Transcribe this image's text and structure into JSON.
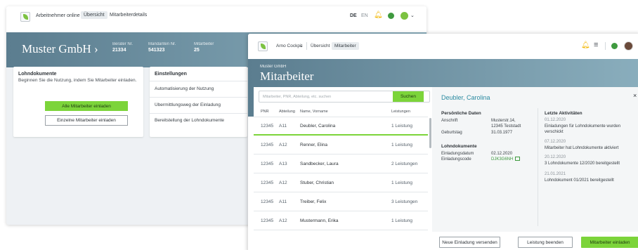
{
  "back": {
    "app_name": "Arbeitnehmer online",
    "tab_overview": "Übersicht",
    "tab_details": "Mitarbeiterdetails",
    "lang_de": "DE",
    "lang_en": "EN",
    "user_chevron": "⌄",
    "company": "Muster GmbH",
    "company_chevron": "›",
    "stats": [
      {
        "label": "Berater Nr.",
        "value": "21334"
      },
      {
        "label": "Mandanten Nr.",
        "value": "541323"
      },
      {
        "label": "Mitarbeiter",
        "value": "25"
      }
    ],
    "docs": {
      "title": "Lohndokumente",
      "description": "Beginnen Sie die Nutzung, indem Sie Mitarbeiter einladen.",
      "btn_all": "Alle Mitarbeiter einladen",
      "btn_single": "Einzelne Mitarbeiter einladen"
    },
    "settings": {
      "title": "Einstellungen",
      "items": [
        "Automatisierung der Nutzung",
        "Übermittlungsweg der Einladung",
        "Bereitstellung der Lohndokumente"
      ]
    }
  },
  "front": {
    "app_name": "Arno Cockpit",
    "app_chevron": "⌄",
    "tab_overview": "Übersicht",
    "tab_employees": "Mitarbeiter",
    "company": "Muster GmbH",
    "title": "Mitarbeiter",
    "search": {
      "placeholder": "Mitarbeiter, PNR, Abteilung, etc. suchen",
      "button": "Suchen"
    },
    "table": {
      "headers": [
        "PNR",
        "Abteilung",
        "Name, Vorname",
        "Leistungen"
      ],
      "rows": [
        {
          "pnr": "12345",
          "dept": "A11",
          "name": "Deubler, Carolina",
          "services": "1 Leistung"
        },
        {
          "pnr": "12345",
          "dept": "A12",
          "name": "Renner, Elina",
          "services": "1 Leistung"
        },
        {
          "pnr": "12345",
          "dept": "A13",
          "name": "Sandbecker, Laura",
          "services": "2 Leistungen"
        },
        {
          "pnr": "12345",
          "dept": "A12",
          "name": "Stuber, Christian",
          "services": "1 Leistung"
        },
        {
          "pnr": "12345",
          "dept": "A11",
          "name": "Treiber, Felix",
          "services": "3 Leistungen"
        },
        {
          "pnr": "12345",
          "dept": "A12",
          "name": "Mustermann, Erika",
          "services": "1 Leistung"
        }
      ]
    },
    "detail": {
      "name": "Deubler, Carolina",
      "close": "×",
      "personal_title": "Persönliche Daten",
      "address_label": "Anschrift",
      "address_line1": "Musterstr.14,",
      "address_line2": "12345 Teststadt",
      "birthday_label": "Geburtstag",
      "birthday_value": "31.03.1977",
      "docs_title": "Lohndokumente",
      "invite_date_label": "Einladungsdatum",
      "invite_date_value": "02.12.2020",
      "invite_code_label": "Einladungscode",
      "invite_code_value": "DJK3G6NH",
      "activity_title": "Letzte Aktivitäten",
      "activities": [
        {
          "date": "01.12.2020",
          "text": "Einladungen für Lohndokumente wurden verschickt"
        },
        {
          "date": "07.12.2020",
          "text": "Mitarbeiter hat Lohndokumente aktiviert"
        },
        {
          "date": "20.12.2020",
          "text": "3 Lohndokumente 12/2020 bereitgestellt"
        },
        {
          "date": "21.01.2021",
          "text": "Lohndokument 01/2021 bereitgestellt"
        }
      ]
    },
    "footer": {
      "btn_resend": "Neue Einladung versenden",
      "btn_end": "Leistung beenden",
      "btn_invite": "Mitarbeiter einladen"
    }
  },
  "colors": {
    "accent_green": "#7cd43a",
    "hero_blue": "#5b7d8f",
    "name_blue": "#2a8aa0",
    "bell_yellow": "#f2b705"
  },
  "icons": [
    "logo-icon",
    "bell-icon",
    "help-icon",
    "user-icon",
    "menu-icon",
    "avatar",
    "copy-icon",
    "close-icon"
  ]
}
